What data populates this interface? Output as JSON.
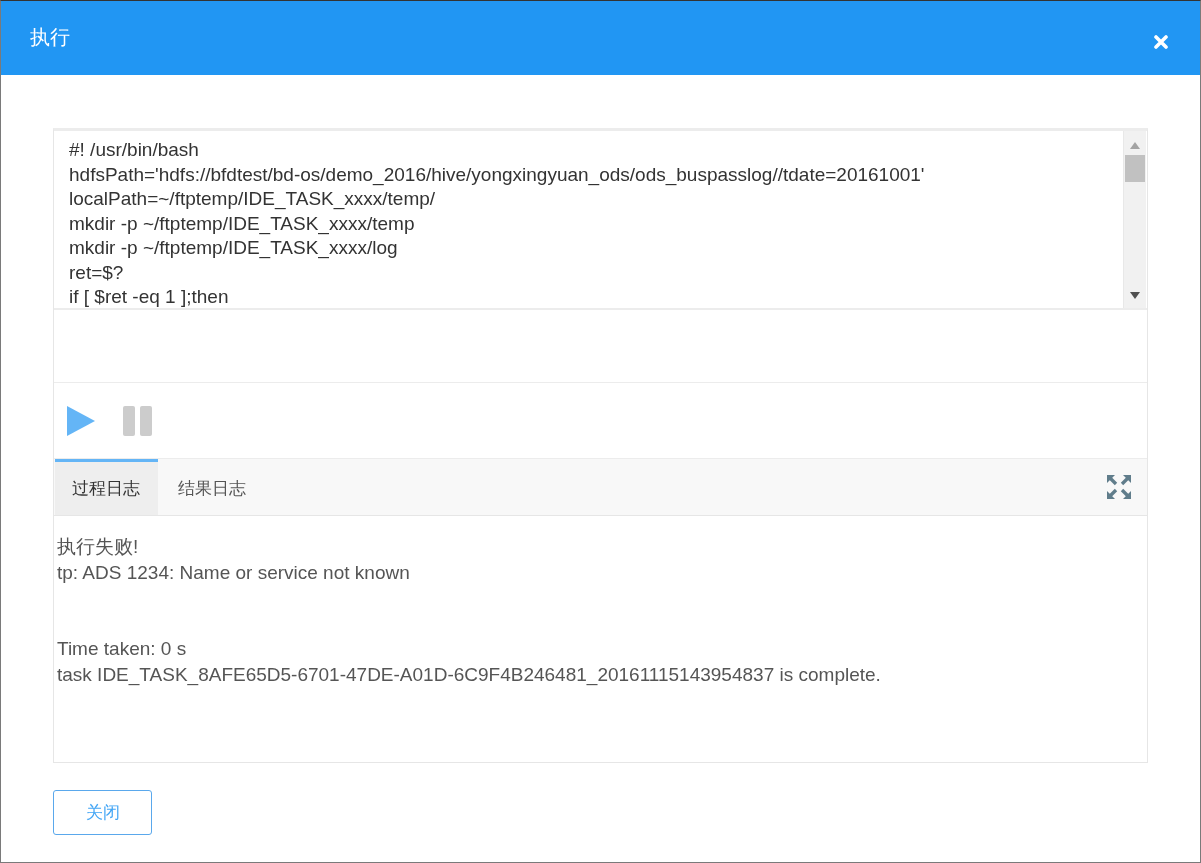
{
  "dialog": {
    "title": "执行"
  },
  "editor": {
    "lines": [
      "#! /usr/bin/bash",
      "hdfsPath='hdfs://bfdtest/bd-os/demo_2016/hive/yongxingyuan_ods/ods_buspasslog//tdate=20161001'",
      "localPath=~/ftptemp/IDE_TASK_xxxx/temp/",
      "mkdir -p ~/ftptemp/IDE_TASK_xxxx/temp",
      "mkdir -p ~/ftptemp/IDE_TASK_xxxx/log",
      "ret=$?",
      "if [ $ret -eq 1 ];then"
    ]
  },
  "toolbar": {
    "buttons": [
      {
        "kind": "play",
        "disabled": false
      },
      {
        "kind": "pause",
        "disabled": true
      }
    ]
  },
  "log_tabs": [
    {
      "label": "过程日志",
      "selected": true
    },
    {
      "label": "结果日志",
      "selected": false
    }
  ],
  "log": {
    "blocks": [
      {
        "lines": [
          "执行失败!",
          "tp: ADS 1234: Name or service not known"
        ]
      },
      {
        "lines": [
          "Time taken: 0 s",
          "task IDE_TASK_8AFE65D5-6701-47DE-A01D-6C9F4B246481_20161115143954837 is complete."
        ]
      }
    ]
  },
  "footer": {
    "close_button": "关闭"
  }
}
